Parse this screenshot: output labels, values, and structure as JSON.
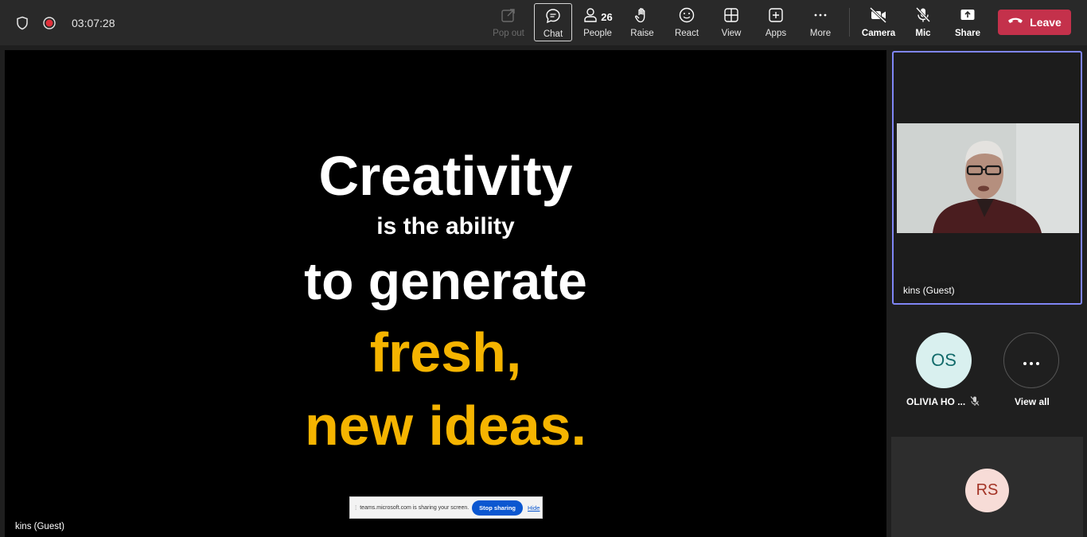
{
  "meeting": {
    "timer": "03:07:28"
  },
  "toolbar": {
    "popout_label": "Pop out",
    "chat_label": "Chat",
    "people_label": "People",
    "people_count": "26",
    "raise_label": "Raise",
    "react_label": "React",
    "view_label": "View",
    "apps_label": "Apps",
    "more_label": "More",
    "camera_label": "Camera",
    "mic_label": "Mic",
    "share_label": "Share",
    "leave_label": "Leave"
  },
  "slide": {
    "line1": "Creativity",
    "line2": "is the ability",
    "line3": "to generate",
    "line4": "fresh,",
    "line5": "new ideas."
  },
  "share_notice": {
    "message": "teams.microsoft.com is sharing your screen.",
    "stop_label": "Stop sharing",
    "hide_label": "Hide"
  },
  "stage": {
    "presenter_name": "kins (Guest)"
  },
  "participants": {
    "speaker_name": "kins (Guest)",
    "os_initials": "OS",
    "os_name": "OLIVIA HO ...",
    "view_all_label": "View all",
    "rs_initials": "RS"
  },
  "colors": {
    "accent": "#7f85f5",
    "leave": "#c4314b",
    "slide_highlight": "#f5b400",
    "record": "#e0303a"
  }
}
